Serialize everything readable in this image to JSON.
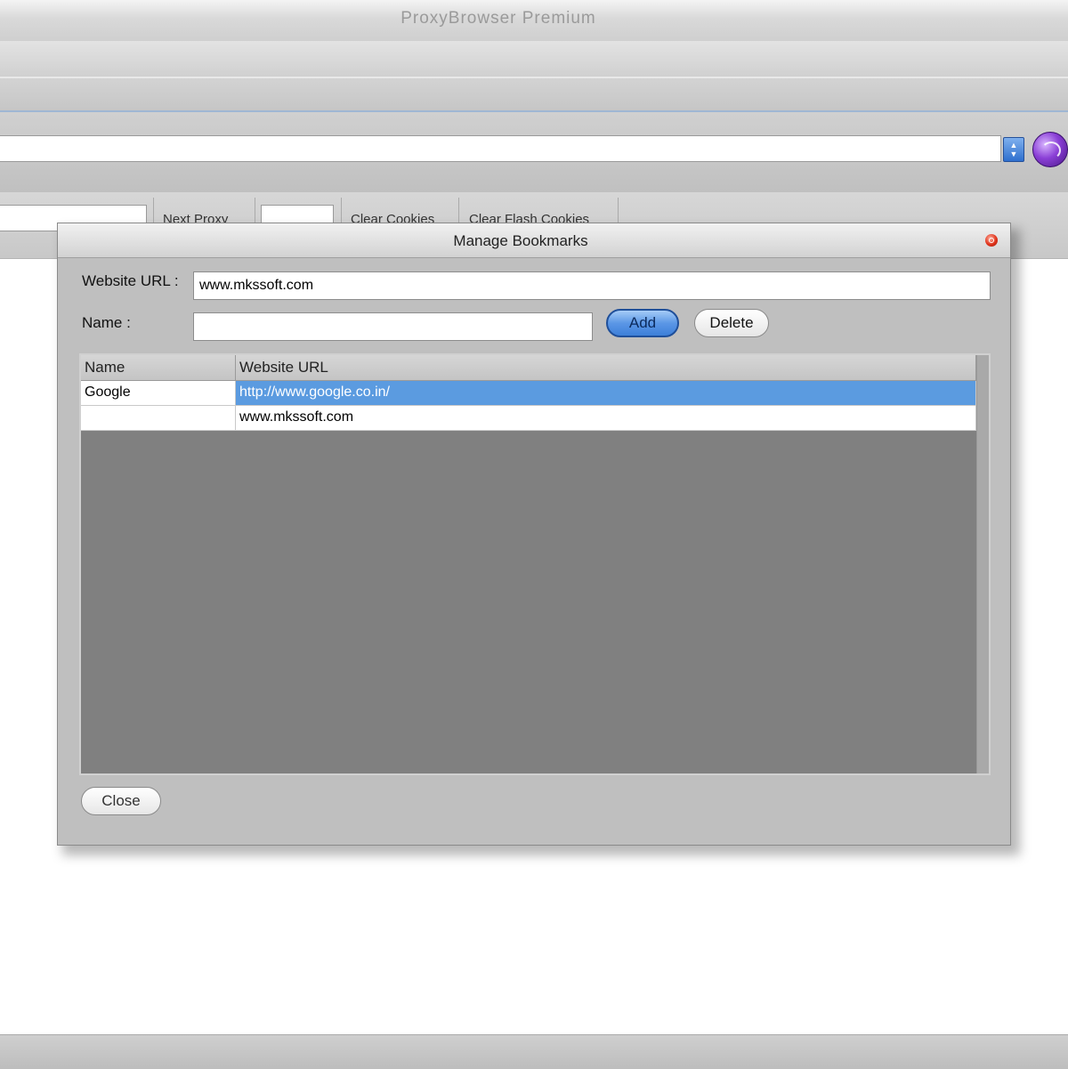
{
  "app": {
    "title": "ProxyBrowser Premium"
  },
  "proxy_toolbar": {
    "next_proxy_label": "Next Proxy",
    "clear_cookies_label": "Clear Cookies",
    "clear_flash_cookies_label": "Clear Flash Cookies"
  },
  "dialog": {
    "title": "Manage Bookmarks",
    "website_url_label": "Website URL :",
    "website_url_value": "www.mkssoft.com",
    "name_label": "Name :",
    "name_value": "",
    "add_label": "Add",
    "delete_label": "Delete",
    "close_label": "Close",
    "table": {
      "columns": [
        "Name",
        "Website URL"
      ],
      "rows": [
        {
          "name": "Google",
          "url": "http://www.google.co.in/",
          "selected": true
        },
        {
          "name": "",
          "url": "www.mkssoft.com",
          "selected": false
        }
      ]
    }
  },
  "colors": {
    "selection": "#5b9be0",
    "grid_empty": "#808080",
    "dialog_bg": "#bfbfbf",
    "add_button": "#5b97e6"
  },
  "icons": [
    "dropdown-arrow-icon",
    "globe-icon",
    "close-icon"
  ]
}
